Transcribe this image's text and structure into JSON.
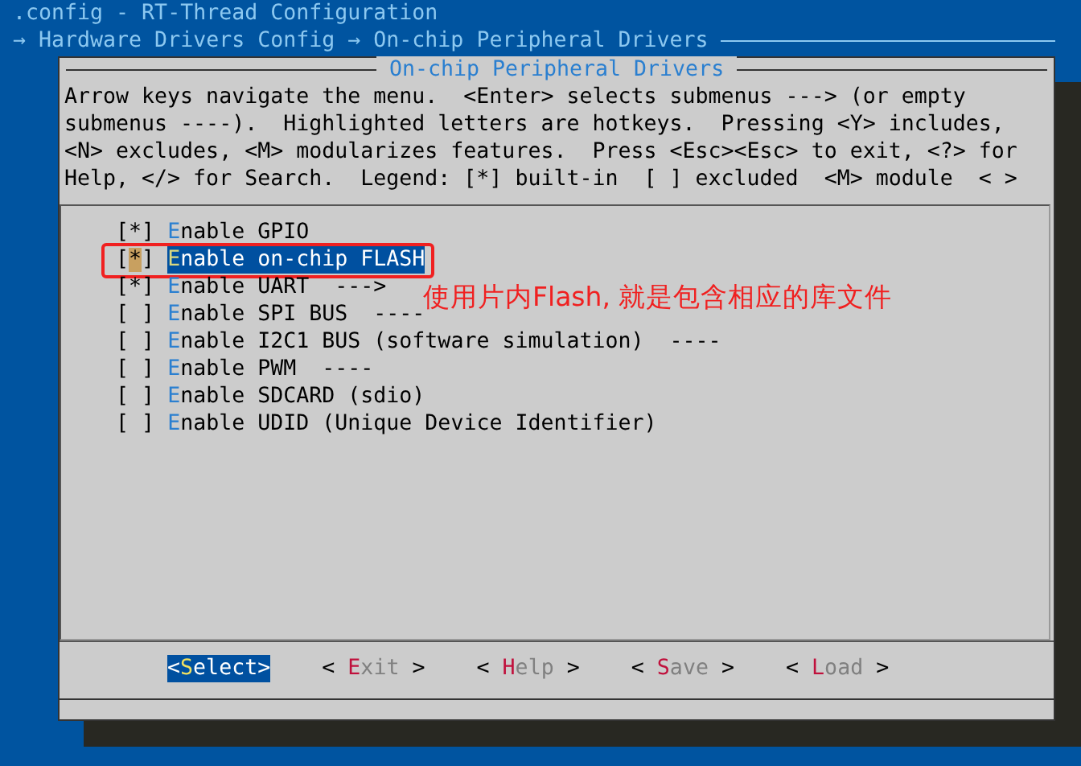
{
  "window": {
    "title": ".config - RT-Thread Configuration"
  },
  "breadcrumb": "→ Hardware Drivers Config → On-chip Peripheral Drivers",
  "dialog": {
    "title": "On-chip Peripheral Drivers",
    "help": [
      "Arrow keys navigate the menu.  <Enter> selects submenus ---> (or empty",
      "submenus ----).  Highlighted letters are hotkeys.  Pressing <Y> includes,",
      "<N> excludes, <M> modularizes features.  Press <Esc><Esc> to exit, <?> for",
      "Help, </> for Search.  Legend: [*] built-in  [ ] excluded  <M> module  < >"
    ],
    "items": [
      {
        "box": "[*]",
        "label": "Enable GPIO",
        "selected": false
      },
      {
        "box": "[*]",
        "label": "Enable on-chip FLASH",
        "selected": true
      },
      {
        "box": "[*]",
        "label": "Enable UART  --->",
        "selected": false
      },
      {
        "box": "[ ]",
        "label": "Enable SPI BUS  ----",
        "selected": false
      },
      {
        "box": "[ ]",
        "label": "Enable I2C1 BUS (software simulation)  ----",
        "selected": false
      },
      {
        "box": "[ ]",
        "label": "Enable PWM  ----",
        "selected": false
      },
      {
        "box": "[ ]",
        "label": "Enable SDCARD (sdio)",
        "selected": false
      },
      {
        "box": "[ ]",
        "label": "Enable UDID (Unique Device Identifier)",
        "selected": false
      }
    ],
    "buttons": [
      {
        "label": "<Select>",
        "selected": true
      },
      {
        "label": "< Exit >",
        "selected": false
      },
      {
        "label": "< Help >",
        "selected": false
      },
      {
        "label": "< Save >",
        "selected": false
      },
      {
        "label": "< Load >",
        "selected": false
      }
    ]
  },
  "annotation": {
    "text": "使用片内Flash, 就是包含相应的库文件"
  }
}
